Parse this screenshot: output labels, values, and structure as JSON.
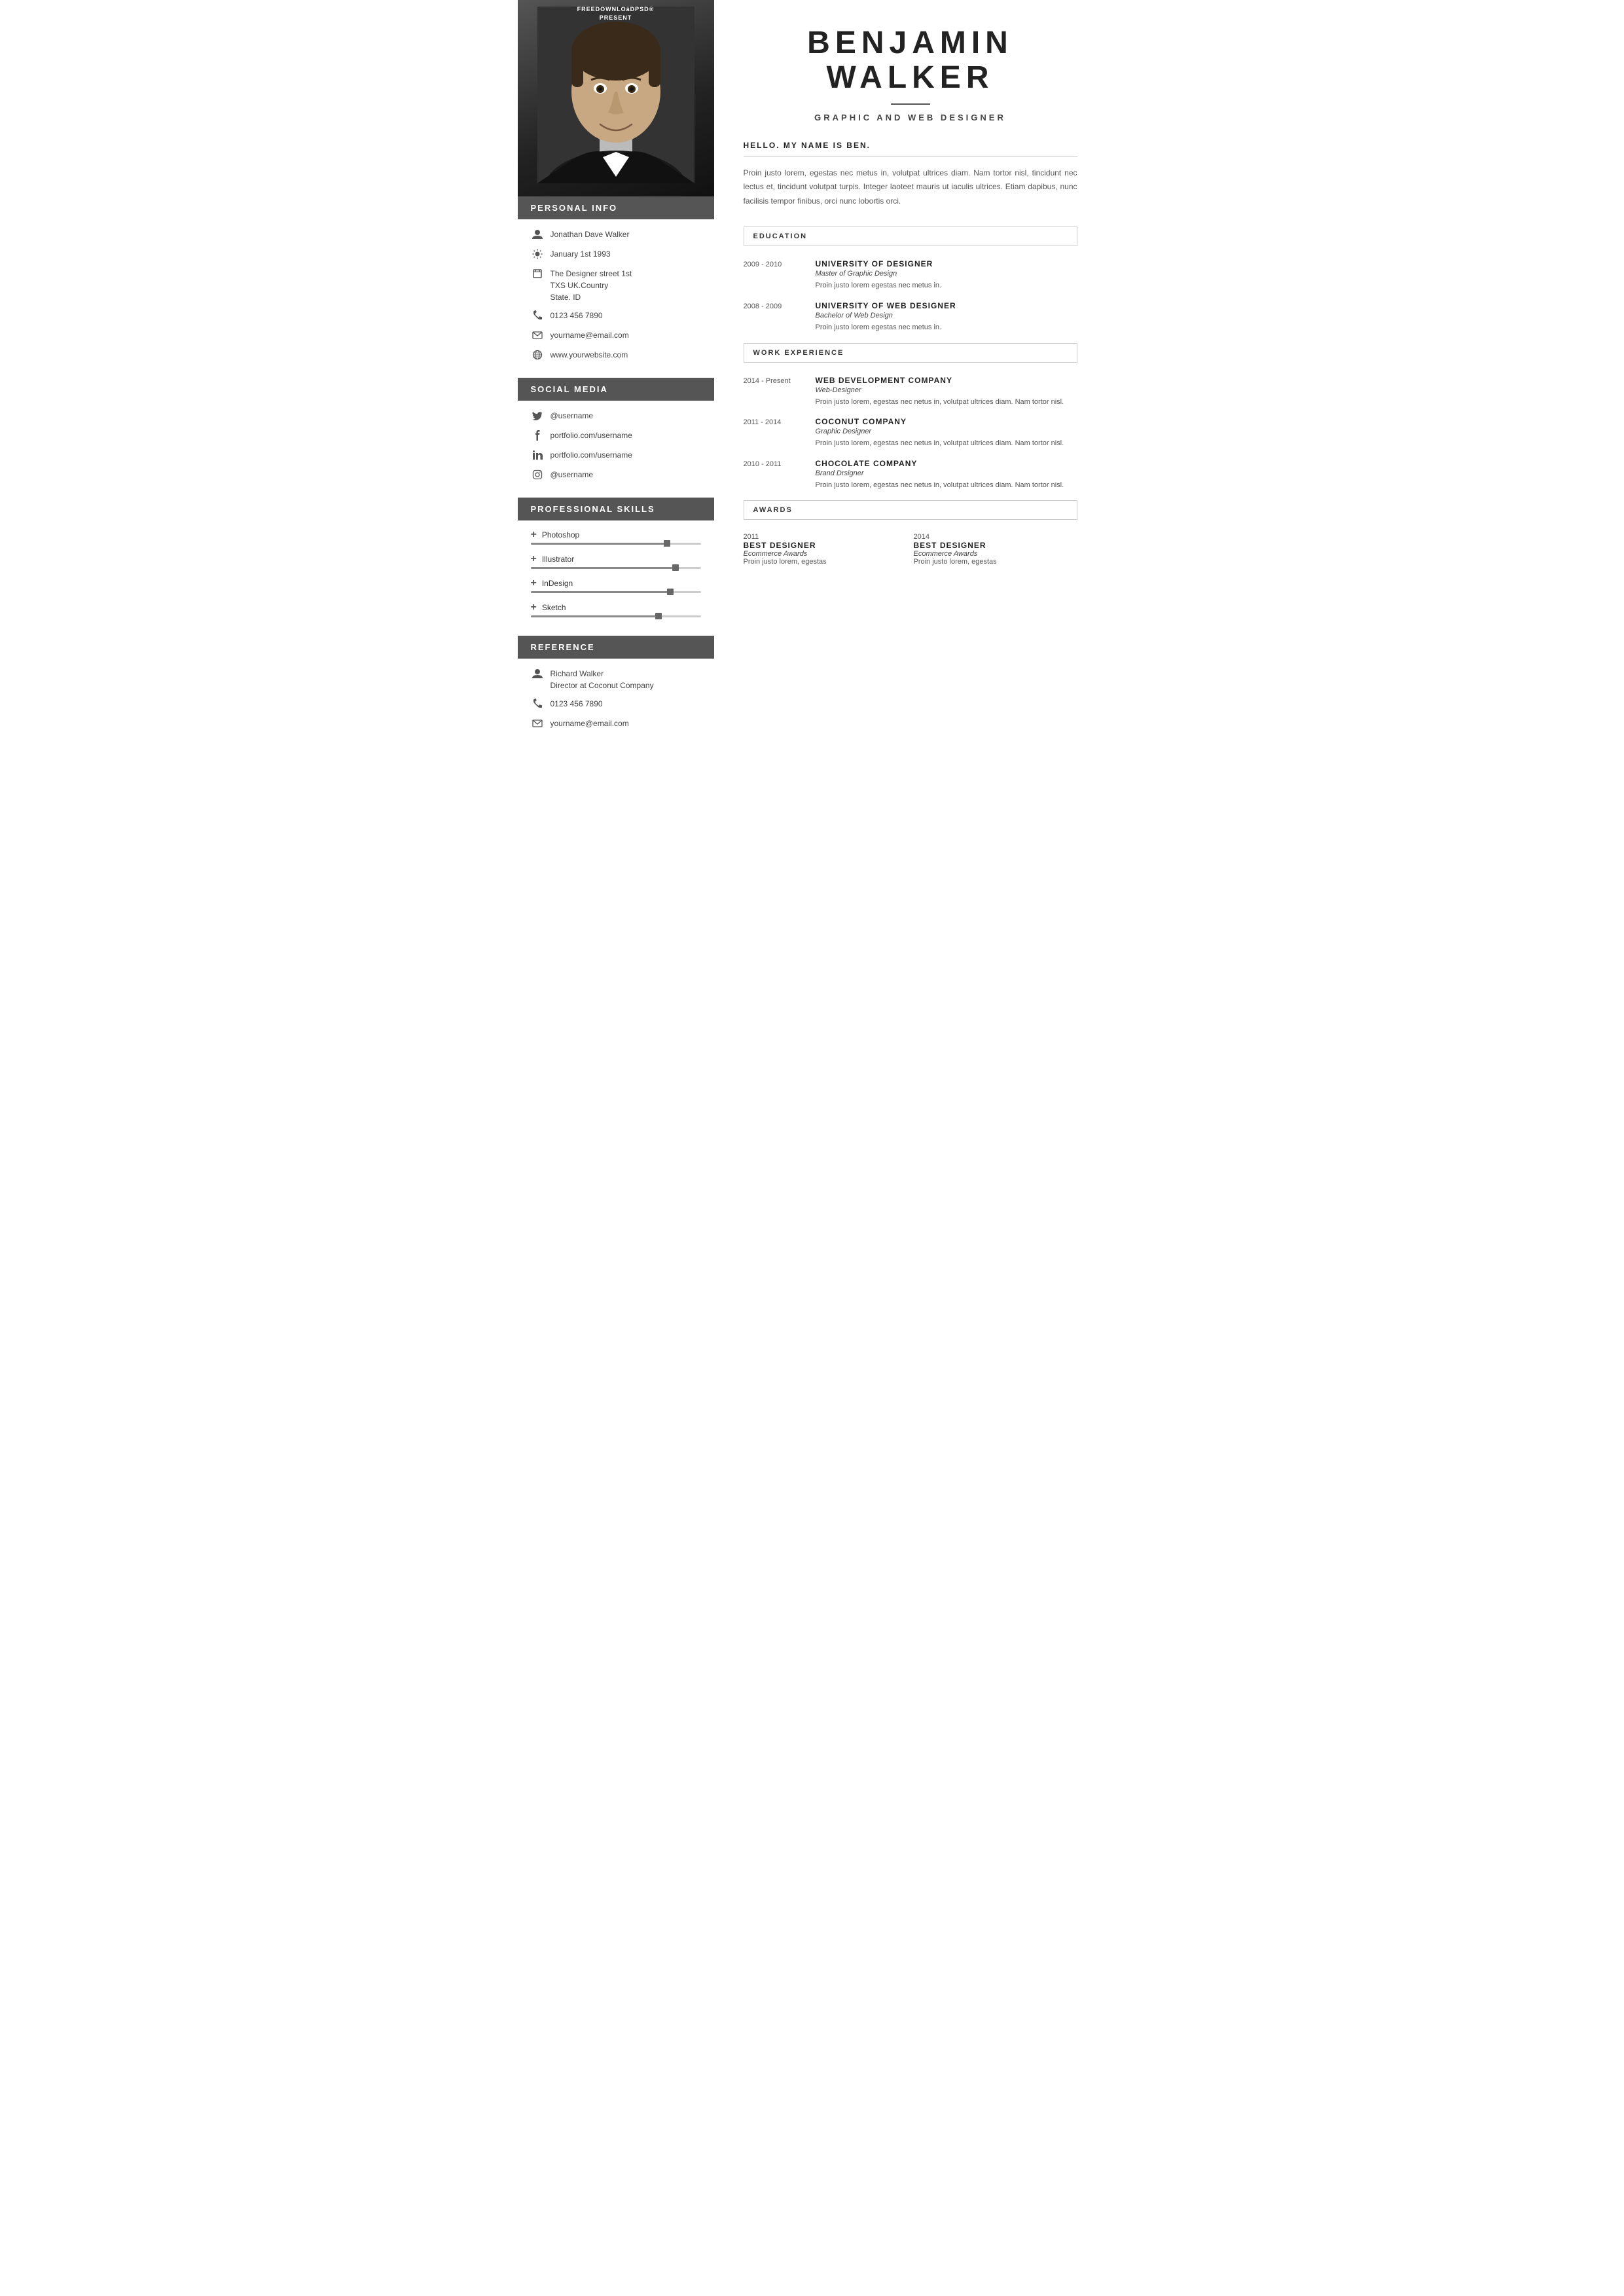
{
  "watermark": {
    "line1": "FREEDOWNLOäDPSD®",
    "line2": "PRESENT"
  },
  "sidebar": {
    "sections": {
      "personal_info": {
        "header": "PERSONAL INFO",
        "items": [
          {
            "icon": "person",
            "text": "Jonathan Dave Walker",
            "type": "name"
          },
          {
            "icon": "sun",
            "text": "January 1st 1993",
            "type": "dob"
          },
          {
            "icon": "address",
            "text": "The Designer street 1st\nTXS UK.Country\nState. ID",
            "type": "address"
          },
          {
            "icon": "phone",
            "text": "0123 456 7890",
            "type": "phone"
          },
          {
            "icon": "email",
            "text": "yourname@email.com",
            "type": "email"
          },
          {
            "icon": "web",
            "text": "www.yourwebsite.com",
            "type": "website"
          }
        ]
      },
      "social_media": {
        "header": "SOCIAL MEDIA",
        "items": [
          {
            "icon": "twitter",
            "text": "@username"
          },
          {
            "icon": "facebook",
            "text": "portfolio.com/username"
          },
          {
            "icon": "linkedin",
            "text": "portfolio.com/username"
          },
          {
            "icon": "instagram",
            "text": "@username"
          }
        ]
      },
      "skills": {
        "header": "PROFESSIONAL  SKILLS",
        "items": [
          {
            "name": "Photoshop",
            "percent": 80
          },
          {
            "name": "Illustrator",
            "percent": 85
          },
          {
            "name": "InDesign",
            "percent": 82
          },
          {
            "name": "Sketch",
            "percent": 75
          }
        ]
      },
      "reference": {
        "header": "REFERENCE",
        "items": [
          {
            "icon": "person",
            "text": "Richard Walker\nDirector at Coconut Company"
          },
          {
            "icon": "phone",
            "text": "0123 456 7890"
          },
          {
            "icon": "email",
            "text": "yourname@email.com"
          }
        ]
      }
    }
  },
  "main": {
    "name_line1": "BENJAMIN",
    "name_line2": "WALKER",
    "title": "GRAPHIC AND WEB DESIGNER",
    "greeting": "HELLO. MY NAME IS BEN.",
    "intro": "Proin justo lorem, egestas nec metus in, volutpat ultrices diam. Nam tortor nisl, tincidunt nec lectus et, tincidunt volutpat turpis. Integer laoteet mauris ut iaculis ultrices. Etiam dapibus, nunc facilisis tempor finibus, orci nunc lobortis orci.",
    "education": {
      "section_title": "EDUCATION",
      "entries": [
        {
          "years": "2009 - 2010",
          "company": "UNIVERSITY OF DESIGNER",
          "role": "Master of Graphic Design",
          "desc": "Proin justo lorem egestas nec metus in."
        },
        {
          "years": "2008 - 2009",
          "company": "UNIVERSITY OF WEB DESIGNER",
          "role": "Bachelor of Web Design",
          "desc": "Proin justo lorem egestas nec metus in."
        }
      ]
    },
    "work_experience": {
      "section_title": "WORK EXPERIENCE",
      "entries": [
        {
          "years": "2014 - Present",
          "company": "WEB DEVELOPMENT COMPANY",
          "role": "Web-Designer",
          "desc": "Proin justo lorem, egestas nec netus in, volutpat ultrices diam. Nam tortor nisl."
        },
        {
          "years": "2011 - 2014",
          "company": "COCONUT COMPANY",
          "role": "Graphic Designer",
          "desc": "Proin justo lorem, egestas nec netus in, volutpat ultrices diam. Nam tortor nisl."
        },
        {
          "years": "2010 - 2011",
          "company": "CHOCOLATE  COMPANY",
          "role": "Brand Drsigner",
          "desc": "Proin justo lorem, egestas nec netus in, volutpat ultrices diam. Nam tortor nisl."
        }
      ]
    },
    "awards": {
      "section_title": "AWARDS",
      "entries": [
        {
          "year": "2011",
          "title": "BEST  DESIGNER",
          "sub": "Ecommerce Awards",
          "desc": "Proin justo  lorem, egestas"
        },
        {
          "year": "2014",
          "title": "BEST  DESIGNER",
          "sub": "Ecommerce Awards",
          "desc": "Proin justo  lorem, egestas"
        }
      ]
    }
  }
}
